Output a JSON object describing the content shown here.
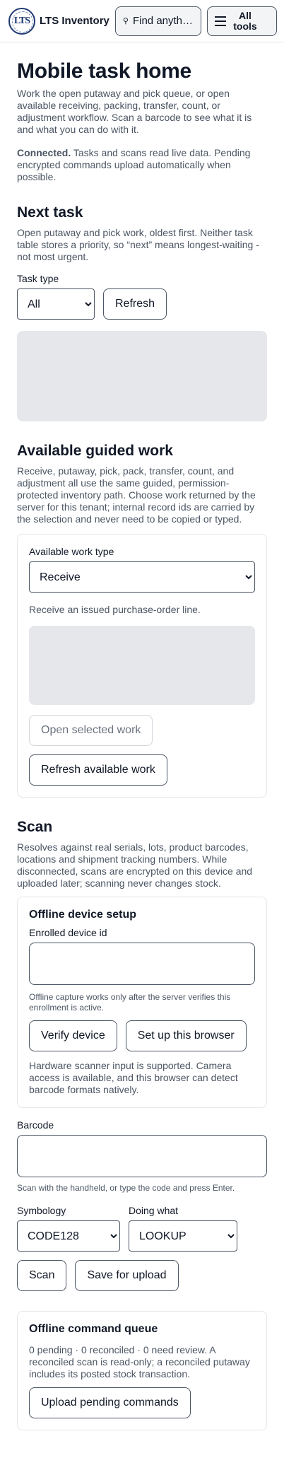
{
  "header": {
    "brand_name": "LTS Inventory",
    "logo_text": "LTS",
    "find_label": "Find anythi…",
    "tools_label_line1": "All",
    "tools_label_line2": "tools"
  },
  "page": {
    "title": "Mobile task home",
    "intro": "Work the open putaway and pick queue, or open available receiving, packing, transfer, count, or adjustment workflow. Scan a barcode to see what it is and what you can do with it.",
    "connection_status": "Connected.",
    "connection_text": " Tasks and scans read live data. Pending encrypted commands upload automatically when possible."
  },
  "next_task": {
    "heading": "Next task",
    "description": "Open putaway and pick work, oldest first. Neither task table stores a priority, so “next” means longest-waiting - not most urgent.",
    "task_type_label": "Task type",
    "task_type_value": "All",
    "refresh_label": "Refresh"
  },
  "guided_work": {
    "heading": "Available guided work",
    "description": "Receive, putaway, pick, pack, transfer, count, and adjustment all use the same guided, permission-protected inventory path. Choose work returned by the server for this tenant; internal record ids are carried by the selection and never need to be copied or typed.",
    "work_type_label": "Available work type",
    "work_type_value": "Receive",
    "work_type_hint": "Receive an issued purchase-order line.",
    "open_selected_label": "Open selected work",
    "refresh_available_label": "Refresh available work"
  },
  "scan": {
    "heading": "Scan",
    "description": "Resolves against real serials, lots, product barcodes, locations and shipment tracking numbers. While disconnected, scans are encrypted on this device and uploaded later; scanning never changes stock.",
    "offline_setup": {
      "heading": "Offline device setup",
      "device_id_label": "Enrolled device id",
      "device_id_value": "",
      "note": "Offline capture works only after the server verifies this enrollment is active.",
      "verify_label": "Verify device",
      "setup_label": "Set up this browser",
      "scanner_note": "Hardware scanner input is supported. Camera access is available, and this browser can detect barcode formats natively."
    },
    "barcode_label": "Barcode",
    "barcode_value": "",
    "barcode_hint": "Scan with the handheld, or type the code and press Enter.",
    "symbology_label": "Symbology",
    "symbology_value": "CODE128",
    "doing_what_label": "Doing what",
    "doing_what_value": "LOOKUP",
    "scan_label": "Scan",
    "save_label": "Save for upload"
  },
  "queue": {
    "heading": "Offline command queue",
    "status": "0 pending · 0 reconciled · 0 need review. A reconciled scan is read-only; a reconciled putaway includes its posted stock transaction.",
    "upload_label": "Upload pending commands"
  }
}
